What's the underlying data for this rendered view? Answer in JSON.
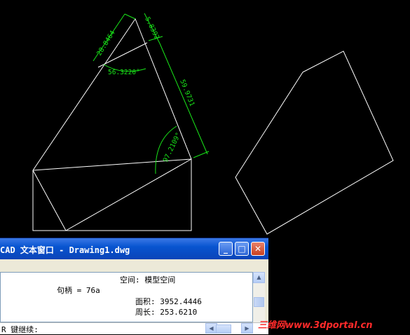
{
  "drawing": {
    "dimensions": {
      "top_left_edge": "28.8464",
      "top_short": "5.8392",
      "right_edge": "59.9731",
      "angle_top": "56.3220°",
      "angle_right": "97.2109°"
    }
  },
  "text_window": {
    "title": "CAD 文本窗口 - Drawing1.dwg",
    "buttons": {
      "minimize": "_",
      "maximize": "□",
      "close": "✕"
    },
    "lines": {
      "space": "空间: 模型空间",
      "handle": "句柄 = 76a",
      "area": "面积: 3952.4446",
      "perimeter": "周长: 253.6210",
      "partial": "..."
    },
    "command_prompt": "R 键继续:"
  },
  "watermark": "三维网www.3dportal.cn",
  "colors": {
    "background": "#000000",
    "geometry": "#ffffff",
    "dimension": "#19e619",
    "titlebar": "#0854d0",
    "watermark": "#ff2a2a"
  }
}
